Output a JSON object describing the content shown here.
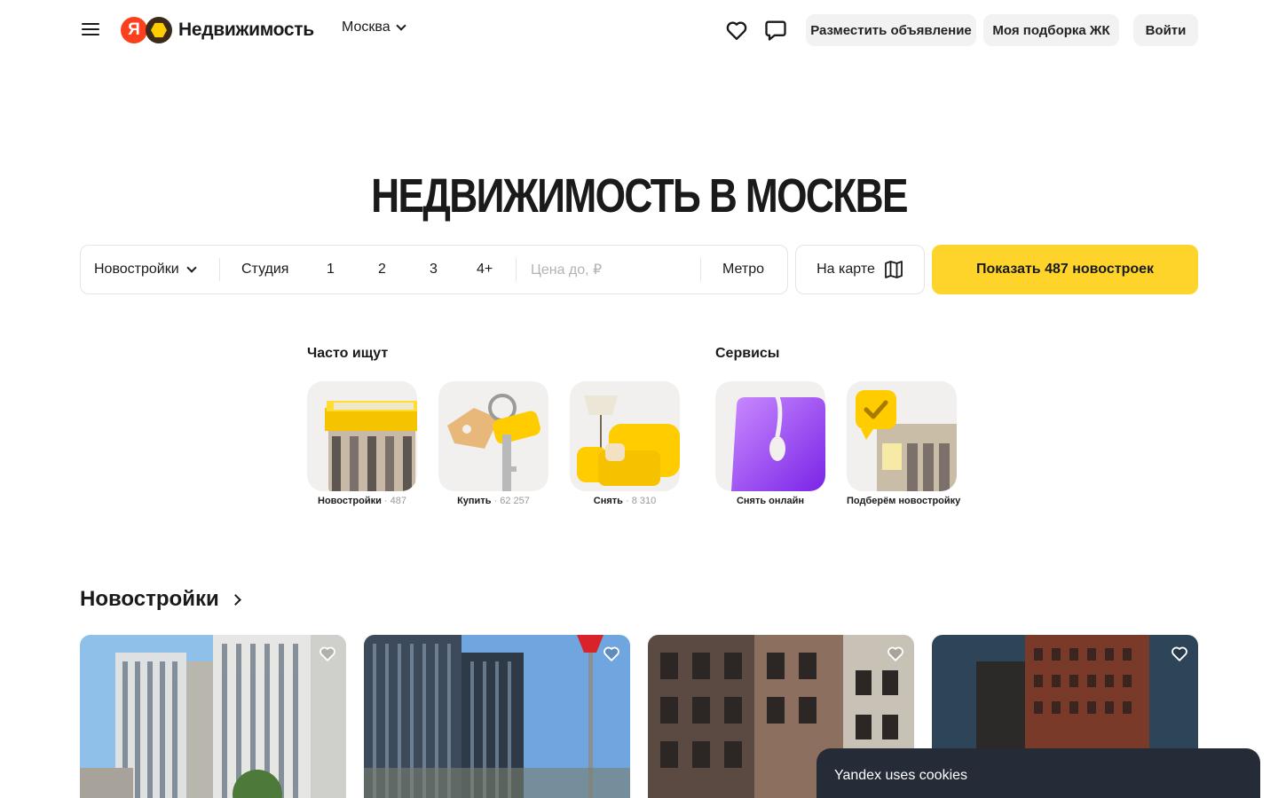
{
  "header": {
    "brand": "Недвижимость",
    "logo_letter": "Я",
    "city": "Москва",
    "post_ad": "Разместить объявление",
    "my_selection": "Моя подборка ЖК",
    "login": "Войти"
  },
  "page_title": "НЕДВИЖИМОСТЬ В МОСКВЕ",
  "search": {
    "category": "Новостройки",
    "rooms": [
      "Студия",
      "1",
      "2",
      "3",
      "4+"
    ],
    "price_placeholder": "Цена до, ₽",
    "metro": "Метро",
    "map": "На карте",
    "show": "Показать 487 новостроек"
  },
  "quick": {
    "often_label": "Часто ищут",
    "services_label": "Сервисы",
    "items": [
      {
        "label": "Новостройки",
        "count": "· 487"
      },
      {
        "label": "Купить",
        "count": "· 62 257"
      },
      {
        "label": "Снять",
        "count": "· 8 310"
      },
      {
        "label": "Снять онлайн",
        "count": ""
      },
      {
        "label": "Подберём новостройку",
        "count": ""
      }
    ]
  },
  "section": {
    "title": "Новостройки"
  },
  "cookie": {
    "text": "Yandex uses cookies"
  },
  "colors": {
    "accent": "#fed42b",
    "yandex_red": "#fc3f1d",
    "cookie_bg": "#262b38"
  }
}
